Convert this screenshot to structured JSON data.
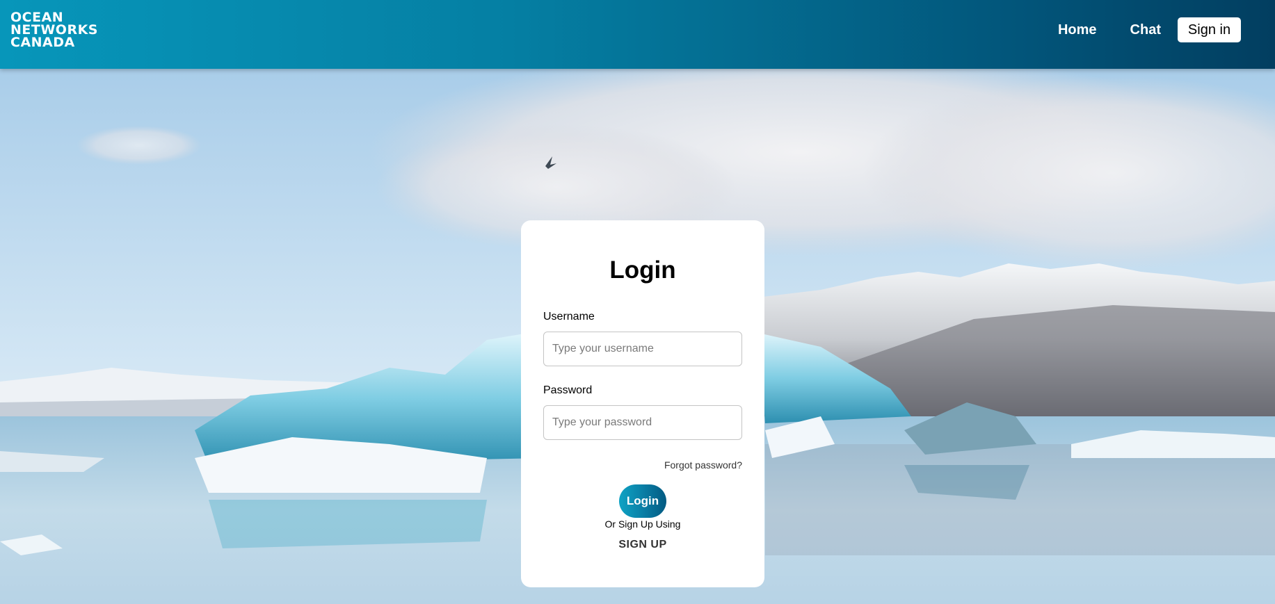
{
  "brand": {
    "logo_lines": [
      "OCEAN",
      "NETWORKS",
      "CANADA"
    ]
  },
  "nav": {
    "home": "Home",
    "chat": "Chat",
    "sign_in": "Sign in"
  },
  "login": {
    "title": "Login",
    "username_label": "Username",
    "username_placeholder": "Type your username",
    "username_value": "",
    "password_label": "Password",
    "password_placeholder": "Type your password",
    "password_value": "",
    "forgot_password": "Forgot password?",
    "login_button": "Login",
    "or_text": "Or Sign Up Using",
    "sign_up": "SIGN UP"
  },
  "colors": {
    "header_start": "#0796ba",
    "header_end": "#023e60",
    "button_accent": "#0a7fa6"
  },
  "background": {
    "icon": "arctic-lake-icebergs-photo"
  }
}
